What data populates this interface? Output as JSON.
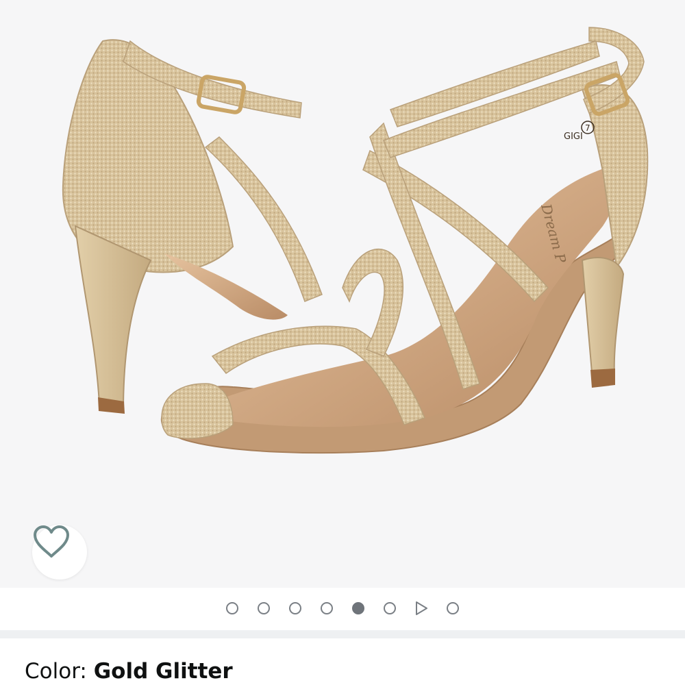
{
  "product": {
    "image_alt": "Gold glitter strappy high heel sandals",
    "insole_brand_text": "Dream P",
    "heel_label_text": "GIGI",
    "size_label_text": "7"
  },
  "wishlist": {
    "icon": "heart-outline-icon",
    "color": "#6f8a8a"
  },
  "carousel": {
    "total_items": 8,
    "active_index": 4,
    "video_index": 6,
    "items": [
      "image",
      "image",
      "image",
      "image",
      "image",
      "image",
      "video",
      "image"
    ]
  },
  "color_selector": {
    "label": "Color: ",
    "value": "Gold Glitter"
  },
  "colors": {
    "background": "#f6f6f7",
    "gold_glitter": "#d9c49f",
    "insole": "#c9a27e",
    "dot_outline": "#7a7f85"
  }
}
